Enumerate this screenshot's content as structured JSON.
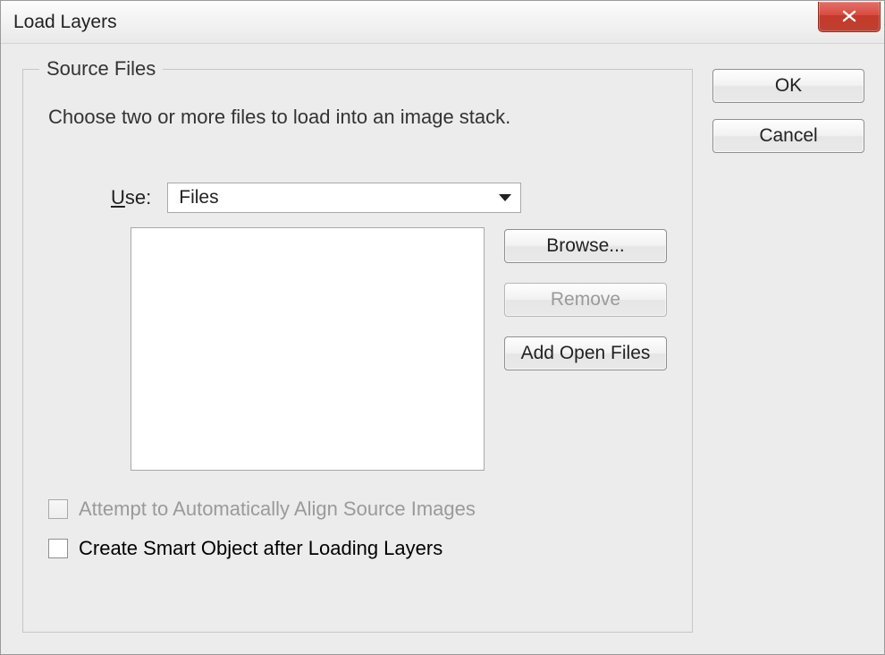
{
  "window": {
    "title": "Load Layers"
  },
  "group": {
    "legend": "Source Files",
    "description": "Choose two or more files to load into an image stack.",
    "use_label_pre": "U",
    "use_label_post": "se:",
    "use_value": "Files",
    "browse_label": "Browse...",
    "remove_label": "Remove",
    "add_open_label": "Add Open Files",
    "align_label": "Attempt to Automatically Align Source Images",
    "smartobj_label": "Create Smart Object after Loading Layers"
  },
  "actions": {
    "ok_label": "OK",
    "cancel_label": "Cancel"
  }
}
